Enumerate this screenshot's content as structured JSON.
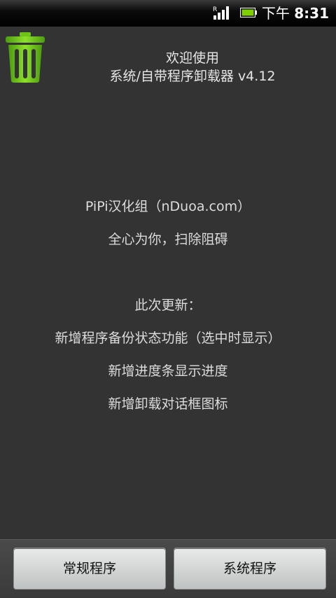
{
  "status_bar": {
    "time_prefix": "下午",
    "time": "8:31",
    "signal_icon": "signal-bars-icon",
    "battery_icon": "battery-icon",
    "battery_color": "#7fd000"
  },
  "header": {
    "icon": "trash-can-icon",
    "icon_color": "#6cc417",
    "line1": "欢迎使用",
    "line2": "系统/自带程序卸载器  v4.12"
  },
  "content": {
    "credit": "PiPi汉化组（nDuoa.com）",
    "slogan": "全心为你，扫除阻碍",
    "update_title": "此次更新：",
    "update_items": [
      "新增程序备份状态功能（选中时显示）",
      "新增进度条显示进度",
      "新增卸载对话框图标"
    ]
  },
  "bottom_bar": {
    "normal_apps_label": "常规程序",
    "system_apps_label": "系统程序"
  }
}
